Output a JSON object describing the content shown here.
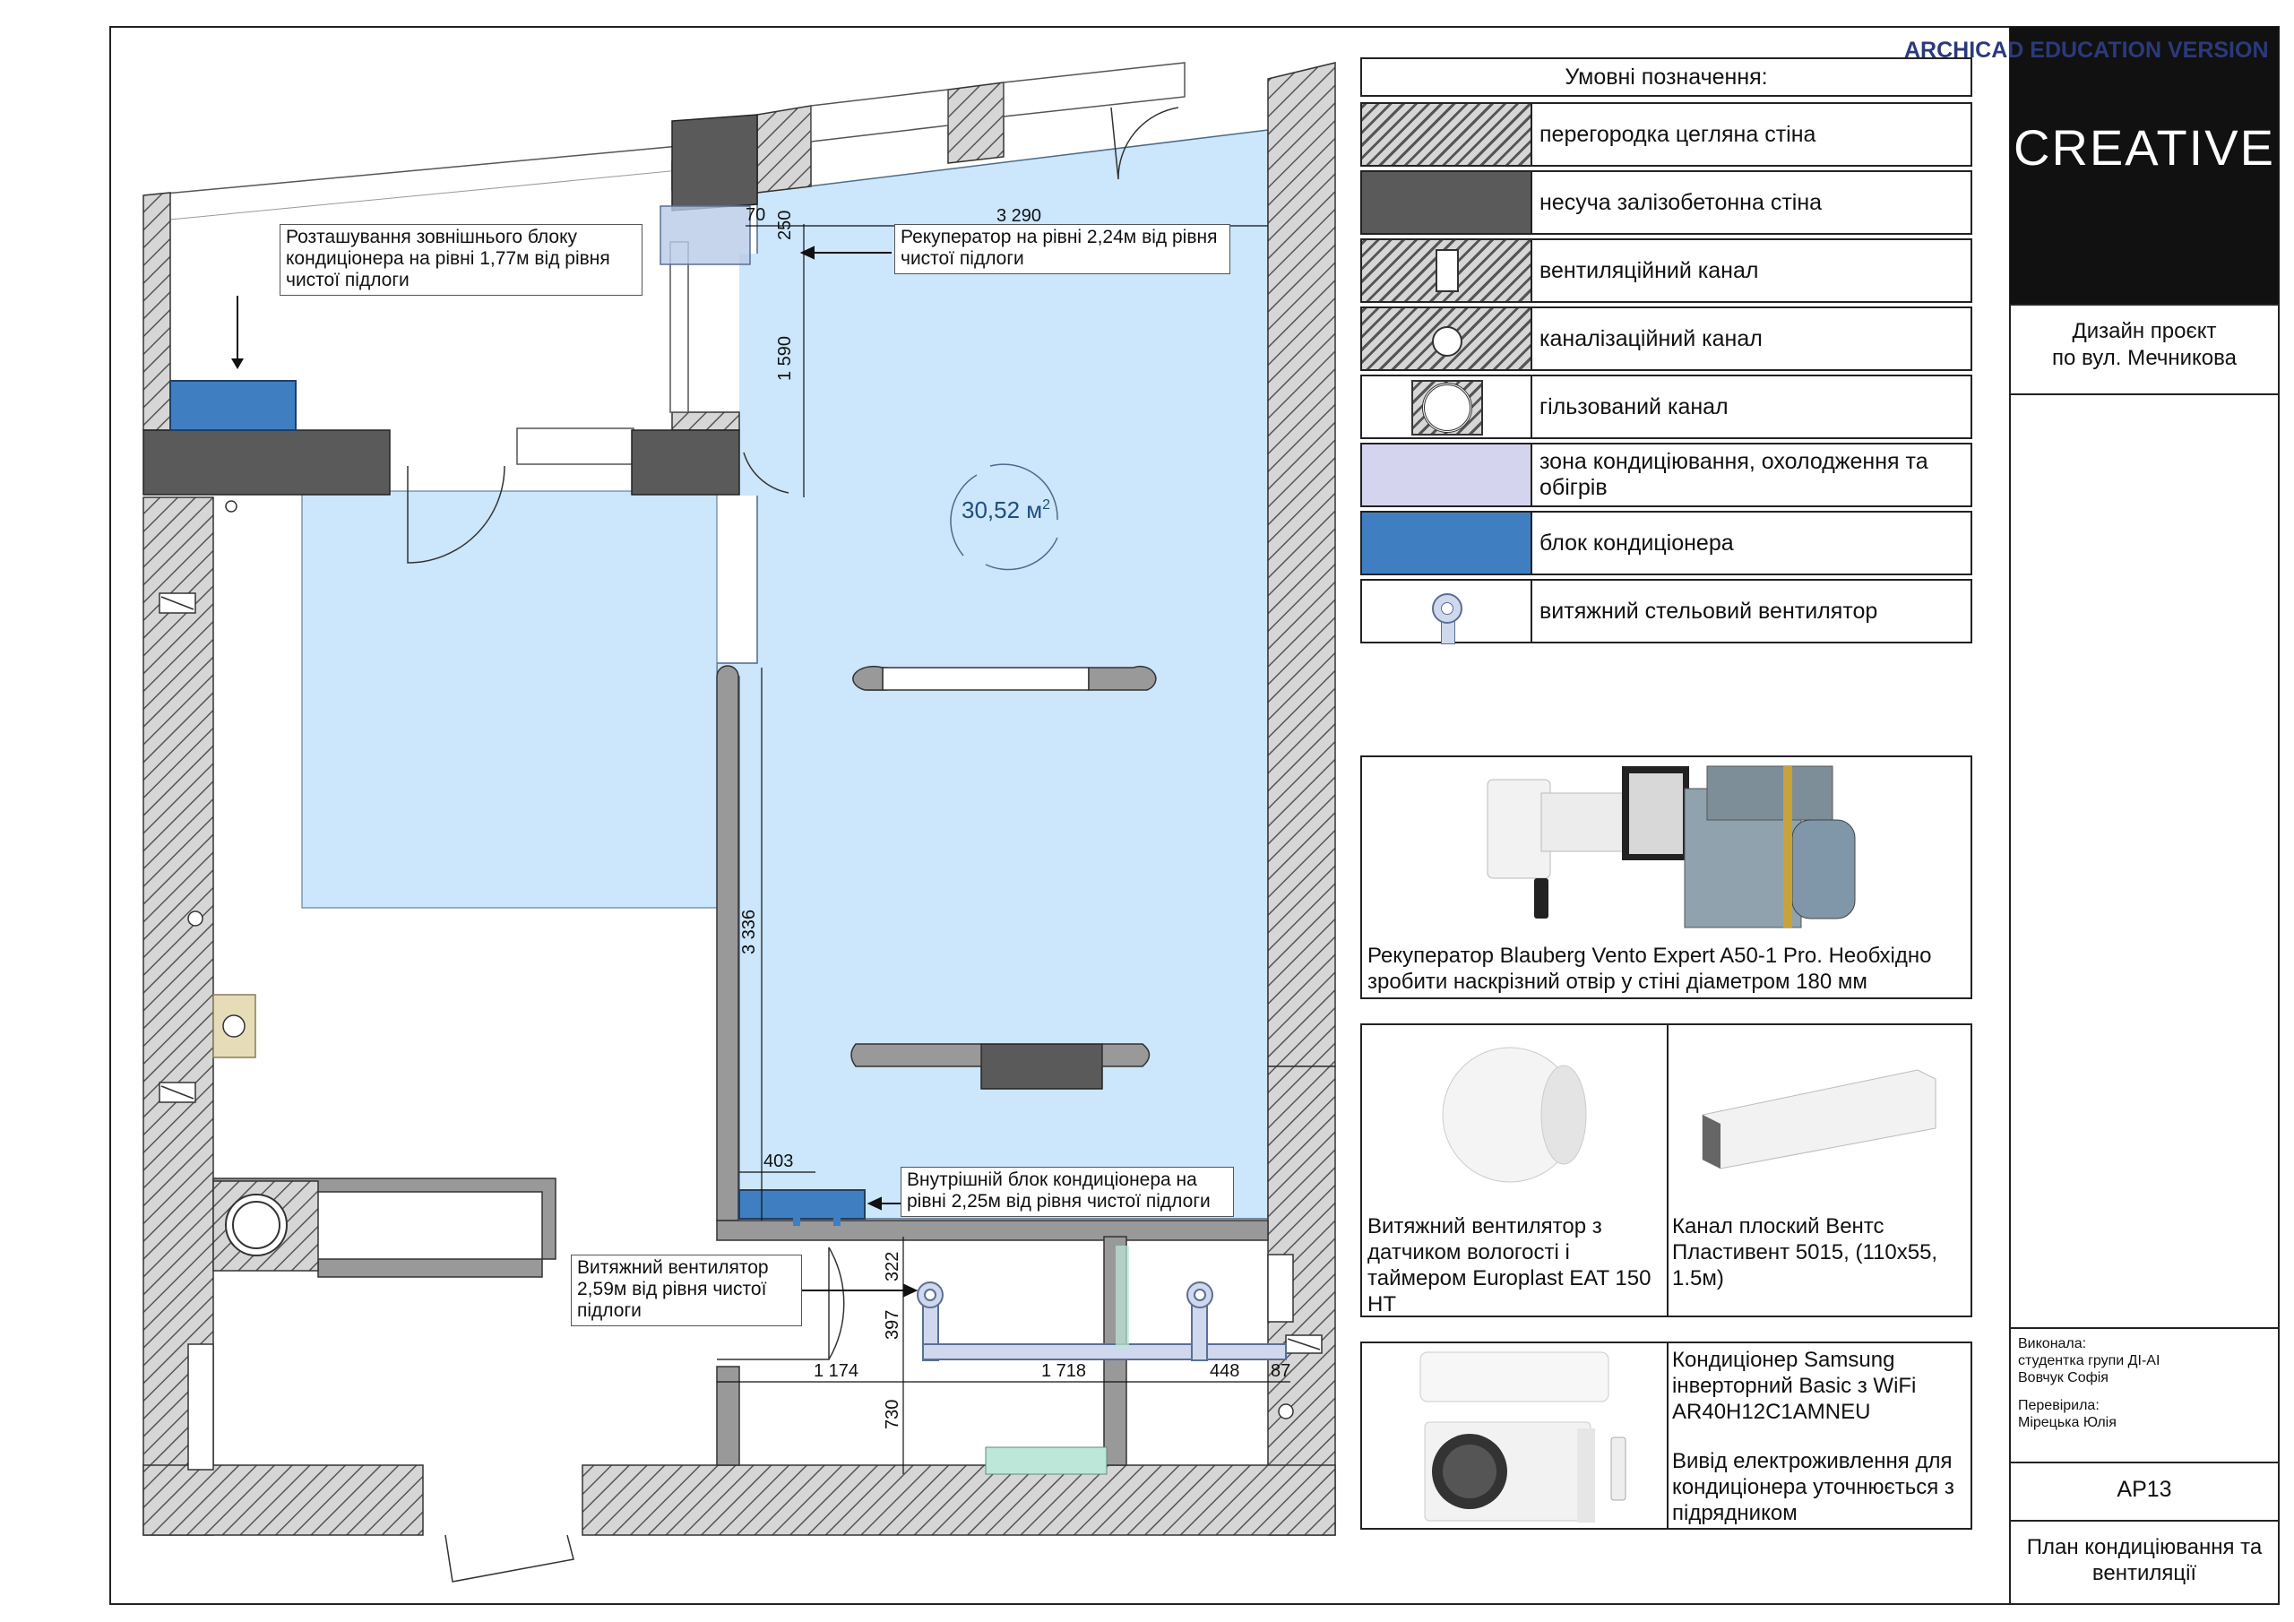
{
  "watermark": "ARCHICAD EDUCATION VERSION",
  "brand": {
    "logo": "CREATIVE",
    "logo_bg": "#111111"
  },
  "colors": {
    "ac_zone": "#cce6fb",
    "ac_unit": "#3f7fc1",
    "hatch_wall": "#707070",
    "rc_wall": "#5a5a5a",
    "outline": "#222222"
  },
  "plan": {
    "area": "30,52 м",
    "area_sup": "2",
    "notes": {
      "outdoor_unit": "Розташування зовнішнього блоку кондиціонера на рівні 1,77м від рівня чистої підлоги",
      "recuperator": "Рекуператор на рівні 2,24м від рівня чистої підлоги",
      "indoor_unit": "Внутрішній блок кондиціонера на рівні 2,25м від рівня чистої підлоги",
      "exhaust_fan": "Витяжний вентилятор 2,59м від рівня чистої підлоги"
    },
    "dims": {
      "d70": "70",
      "d250": "250",
      "d3290": "3 290",
      "d1590": "1 590",
      "d3336": "3 336",
      "d403": "403",
      "d322": "322",
      "d397": "397",
      "d730": "730",
      "d1174": "1 174",
      "d1718": "1 718",
      "d448": "448",
      "d87": "87"
    }
  },
  "legend": {
    "title": "Умовні позначення:",
    "items": [
      {
        "label": "перегородка цегляна стіна",
        "icon": "brick-wall-hatch"
      },
      {
        "label": "несуча залізобетонна стіна",
        "icon": "concrete-wall"
      },
      {
        "label": "вентиляційний канал",
        "icon": "vent-duct"
      },
      {
        "label": "каналізаційний канал",
        "icon": "sewer-duct"
      },
      {
        "label": "гільзований канал",
        "icon": "sleeved-duct"
      },
      {
        "label": "зона кондиціювання, охолодження та обігрів",
        "icon": "ac-zone"
      },
      {
        "label": "блок кондиціонера",
        "icon": "ac-unit"
      },
      {
        "label": "витяжний стельовий вентилятор",
        "icon": "ceiling-fan"
      }
    ]
  },
  "products": {
    "recuperator": "Рекуператор Blauberg Vento Expert A50-1 Pro. Необхідно зробити наскрізний отвір у стіні діаметром 180 мм",
    "fan": "Витяжний вентилятор з датчиком вологості і таймером Europlast EAT 150 HT",
    "channel": "Канал плоский Вентс Пластивент 5015, (110х55, 1.5м)",
    "ac": "Кондиціонер Samsung інверторний Basic з WiFi AR40H12C1AMNEU",
    "ac_power": "Вивід електроживлення для кондиціонера уточнюється з підрядником"
  },
  "title_block": {
    "project_line1": "Дизайн проєкт",
    "project_line2": "по вул. Мечникова",
    "executed_label": "Виконала:",
    "executed_line1": "студентка групи ДІ-АІ",
    "executed_line2": "Вовчук Софія",
    "checked_label": "Перевірила:",
    "checked_name": "Мірецька Юлія",
    "sheet": "АР13",
    "sheet_title": "План кондиціювання та вентиляції"
  }
}
